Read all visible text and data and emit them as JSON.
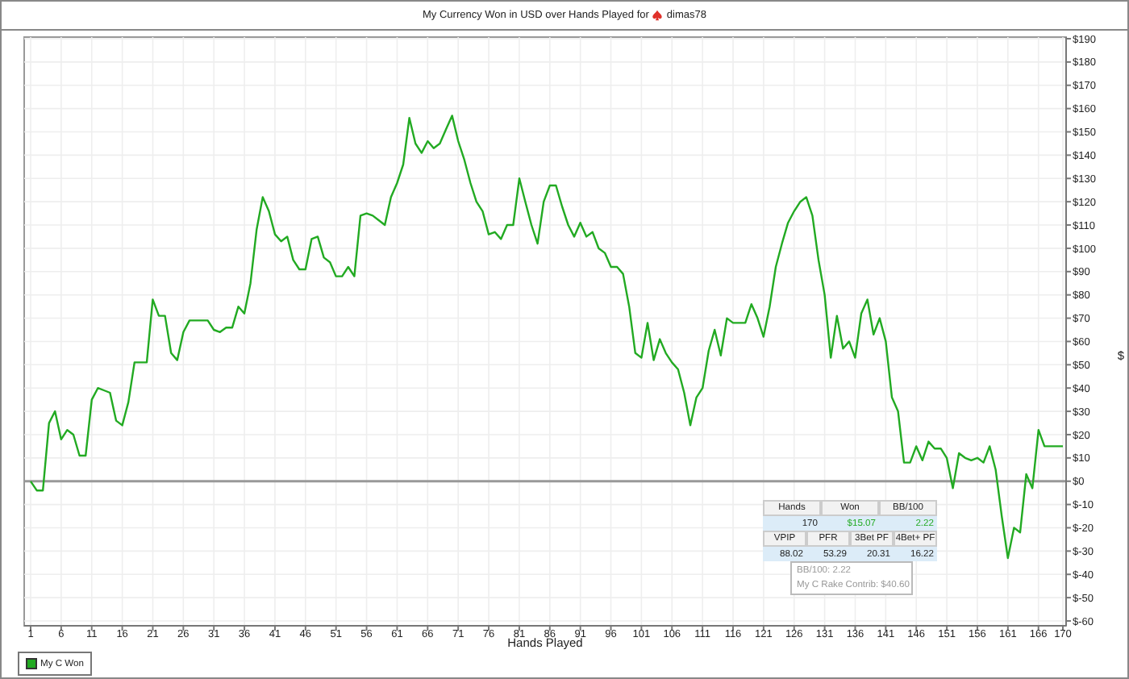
{
  "header": {
    "title": "My Currency Won in USD over Hands Played for",
    "player": "dimas78"
  },
  "chart": {
    "chart_data": {
      "type": "line",
      "grid": true,
      "xlabel": "Hands Played",
      "ylabel": "$",
      "xlim": [
        1,
        170
      ],
      "ylim": [
        -60,
        190
      ],
      "x": [
        1,
        2,
        3,
        4,
        5,
        6,
        7,
        8,
        9,
        10,
        11,
        12,
        13,
        14,
        15,
        16,
        17,
        18,
        19,
        20,
        21,
        22,
        23,
        24,
        25,
        26,
        27,
        28,
        29,
        30,
        31,
        32,
        33,
        34,
        35,
        36,
        37,
        38,
        39,
        40,
        41,
        42,
        43,
        44,
        45,
        46,
        47,
        48,
        49,
        50,
        51,
        52,
        53,
        54,
        55,
        56,
        57,
        58,
        59,
        60,
        61,
        62,
        63,
        64,
        65,
        66,
        67,
        68,
        69,
        70,
        71,
        72,
        73,
        74,
        75,
        76,
        77,
        78,
        79,
        80,
        81,
        82,
        83,
        84,
        85,
        86,
        87,
        88,
        89,
        90,
        91,
        92,
        93,
        94,
        95,
        96,
        97,
        98,
        99,
        100,
        101,
        102,
        103,
        104,
        105,
        106,
        107,
        108,
        109,
        110,
        111,
        112,
        113,
        114,
        115,
        116,
        117,
        118,
        119,
        120,
        121,
        122,
        123,
        124,
        125,
        126,
        127,
        128,
        129,
        130,
        131,
        132,
        133,
        134,
        135,
        136,
        137,
        138,
        139,
        140,
        141,
        142,
        143,
        144,
        145,
        146,
        147,
        148,
        149,
        150,
        151,
        152,
        153,
        154,
        155,
        156,
        157,
        158,
        159,
        160,
        161,
        162,
        163,
        164,
        165,
        166,
        167,
        168,
        169,
        170
      ],
      "series": [
        {
          "name": "My C Won",
          "color": "#22aa22",
          "values": [
            0,
            -4,
            -4,
            25,
            30,
            18,
            22,
            20,
            11,
            11,
            35,
            40,
            39,
            38,
            26,
            24,
            34,
            51,
            51,
            51,
            78,
            71,
            71,
            55,
            52,
            64,
            69,
            69,
            69,
            69,
            65,
            64,
            66,
            66,
            75,
            72,
            85,
            108,
            122,
            116,
            106,
            103,
            105,
            95,
            91,
            91,
            104,
            105,
            96,
            94,
            88,
            88,
            92,
            88,
            114,
            115,
            114,
            112,
            110,
            122,
            128,
            136,
            156,
            145,
            141,
            146,
            143,
            145,
            151,
            157,
            146,
            138,
            128,
            120,
            116,
            106,
            107,
            104,
            110,
            110,
            130,
            120,
            110,
            102,
            120,
            127,
            127,
            118,
            110,
            105,
            111,
            105,
            107,
            100,
            98,
            92,
            92,
            89,
            75,
            55,
            53,
            68,
            52,
            61,
            55,
            51,
            48,
            38,
            24,
            36,
            40,
            56,
            65,
            54,
            70,
            68,
            68,
            68,
            76,
            70,
            62,
            75,
            92,
            102,
            111,
            116,
            120,
            122,
            114,
            95,
            80,
            53,
            71,
            57,
            60,
            53,
            72,
            78,
            63,
            70,
            60,
            36,
            30,
            8,
            8,
            15,
            9,
            17,
            14,
            14,
            10,
            -3,
            12,
            10,
            9,
            10,
            8,
            15,
            5,
            -15,
            -33,
            -20,
            -22,
            3,
            -3,
            22,
            15,
            15,
            15,
            15
          ]
        }
      ],
      "xticks": [
        1,
        6,
        11,
        16,
        21,
        26,
        31,
        36,
        41,
        46,
        51,
        56,
        61,
        66,
        71,
        76,
        81,
        86,
        91,
        96,
        101,
        106,
        111,
        116,
        121,
        126,
        131,
        136,
        141,
        146,
        151,
        156,
        161,
        166,
        170
      ],
      "yticks": [
        {
          "value": -60,
          "label": "$-60"
        },
        {
          "value": -50,
          "label": "$-50"
        },
        {
          "value": -40,
          "label": "$-40"
        },
        {
          "value": -30,
          "label": "$-30"
        },
        {
          "value": -20,
          "label": "$-20"
        },
        {
          "value": -10,
          "label": "$-10"
        },
        {
          "value": 0,
          "label": "$0"
        },
        {
          "value": 10,
          "label": "$10"
        },
        {
          "value": 20,
          "label": "$20"
        },
        {
          "value": 30,
          "label": "$30"
        },
        {
          "value": 40,
          "label": "$40"
        },
        {
          "value": 50,
          "label": "$50"
        },
        {
          "value": 60,
          "label": "$60"
        },
        {
          "value": 70,
          "label": "$70"
        },
        {
          "value": 80,
          "label": "$80"
        },
        {
          "value": 90,
          "label": "$90"
        },
        {
          "value": 100,
          "label": "$100"
        },
        {
          "value": 110,
          "label": "$110"
        },
        {
          "value": 120,
          "label": "$120"
        },
        {
          "value": 130,
          "label": "$130"
        },
        {
          "value": 140,
          "label": "$140"
        },
        {
          "value": 150,
          "label": "$150"
        },
        {
          "value": 160,
          "label": "$160"
        },
        {
          "value": 170,
          "label": "$170"
        },
        {
          "value": 180,
          "label": "$180"
        },
        {
          "value": 190,
          "label": "$190"
        }
      ]
    }
  },
  "summary": {
    "columns": [
      "Hands",
      "Won",
      "BB/100"
    ],
    "values": [
      {
        "text": "170"
      },
      {
        "text": "$15.07",
        "color": "#22aa22"
      },
      {
        "text": "2.22",
        "color": "#22aa22"
      }
    ],
    "columns_2": [
      "VPIP",
      "PFR",
      "3Bet PF",
      "4Bet+ PF"
    ],
    "values_2": [
      {
        "text": "88.02"
      },
      {
        "text": "53.29"
      },
      {
        "text": "20.31"
      },
      {
        "text": "16.22"
      }
    ]
  },
  "tooltip": {
    "lines": [
      "BB/100: 2.22",
      "My C Rake Contrib: $40.60"
    ]
  }
}
